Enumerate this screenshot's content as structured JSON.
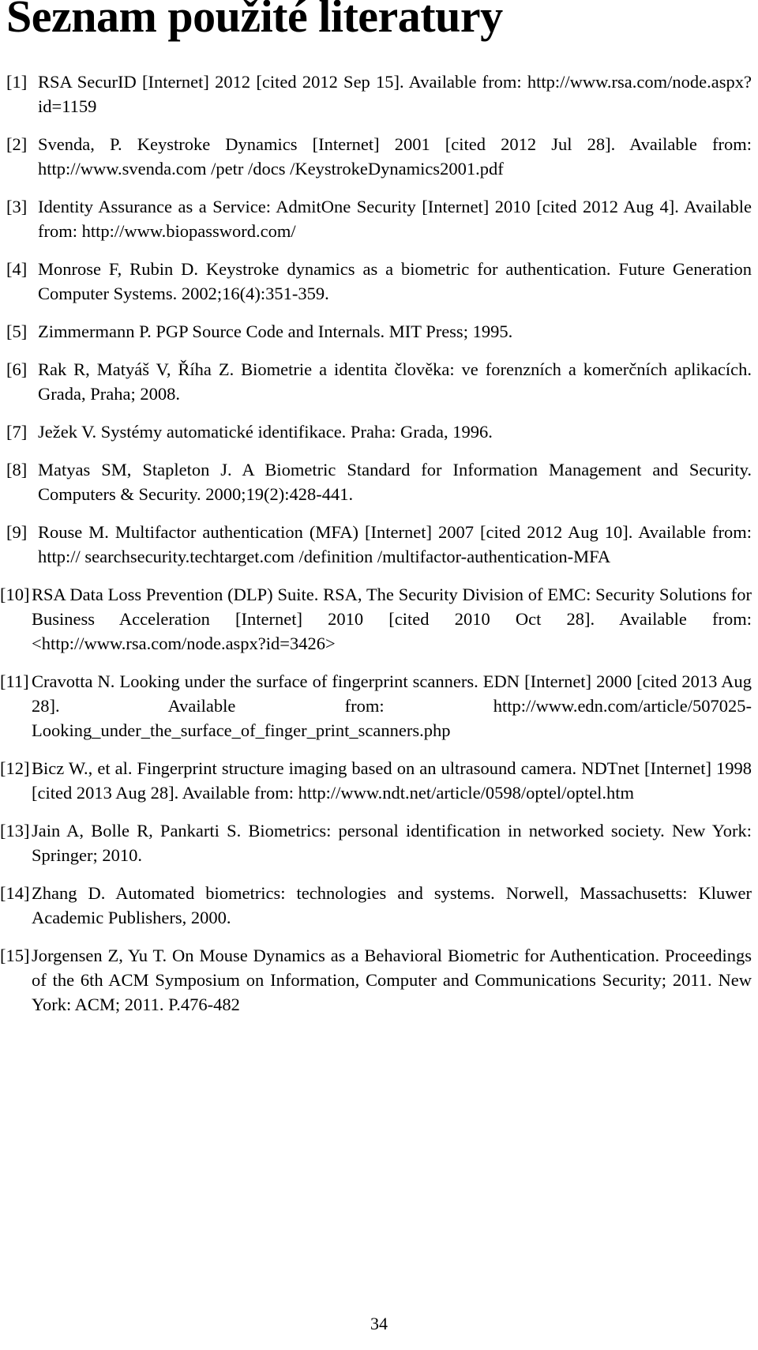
{
  "document": {
    "title": "Seznam použité literatury",
    "page_number": "34"
  },
  "bibliography": {
    "items": [
      {
        "label": "[1]",
        "text": "RSA SecurID [Internet] 2012 [cited 2012 Sep 15]. Available from: http://www.rsa.com/node.aspx?id=1159"
      },
      {
        "label": "[2]",
        "text": "Svenda, P. Keystroke Dynamics [Internet] 2001 [cited 2012 Jul 28]. Available from: http://www.svenda.com /petr /docs /KeystrokeDynamics2001.pdf"
      },
      {
        "label": "[3]",
        "text": "Identity Assurance as a Service: AdmitOne Security [Internet] 2010 [cited 2012 Aug 4]. Available from: http://www.biopassword.com/"
      },
      {
        "label": "[4]",
        "text": "Monrose F, Rubin D. Keystroke dynamics as a biometric for authentication. Future Generation Computer Systems. 2002;16(4):351-359."
      },
      {
        "label": "[5]",
        "text": "Zimmermann P. PGP Source Code and Internals. MIT Press; 1995."
      },
      {
        "label": "[6]",
        "text": "Rak R, Matyáš V, Říha Z. Biometrie a identita člověka: ve forenzních a komerčních aplikacích. Grada, Praha; 2008."
      },
      {
        "label": "[7]",
        "text": "Ježek V. Systémy automatické identifikace. Praha: Grada, 1996."
      },
      {
        "label": "[8]",
        "text": "Matyas SM, Stapleton J. A Biometric Standard for Information Management and Security. Computers & Security. 2000;19(2):428-441."
      },
      {
        "label": "[9]",
        "text": "Rouse M. Multifactor authentication (MFA) [Internet] 2007 [cited 2012 Aug 10]. Available from: http:// searchsecurity.techtarget.com /definition /multifactor-authentication-MFA"
      },
      {
        "label": "[10]",
        "text": "RSA Data Loss Prevention (DLP) Suite. RSA, The Security Division of EMC: Security Solutions for Business Acceleration [Internet] 2010 [cited 2010 Oct 28]. Available from: <http://www.rsa.com/node.aspx?id=3426>"
      },
      {
        "label": "[11]",
        "text": "Cravotta N. Looking under the surface of fingerprint scanners. EDN [Internet] 2000 [cited 2013 Aug 28]. Available from: http://www.edn.com/article/507025-Looking_under_the_surface_of_finger_print_scanners.php"
      },
      {
        "label": "[12]",
        "text": "Bicz W., et al. Fingerprint structure imaging based on an ultrasound camera. NDTnet [Internet] 1998 [cited 2013 Aug 28]. Available from: http://www.ndt.net/article/0598/optel/optel.htm"
      },
      {
        "label": "[13]",
        "text": "Jain A, Bolle R, Pankarti S. Biometrics: personal identification in networked society. New York: Springer; 2010."
      },
      {
        "label": "[14]",
        "text": "Zhang D. Automated biometrics: technologies and systems. Norwell, Massachusetts: Kluwer Academic Publishers, 2000."
      },
      {
        "label": "[15]",
        "text": "Jorgensen Z, Yu T. On Mouse Dynamics as a Behavioral Biometric for Authentication. Proceedings of the 6th ACM Symposium on Information, Computer and Communications Security; 2011. New York: ACM; 2011. P.476-482"
      }
    ]
  }
}
